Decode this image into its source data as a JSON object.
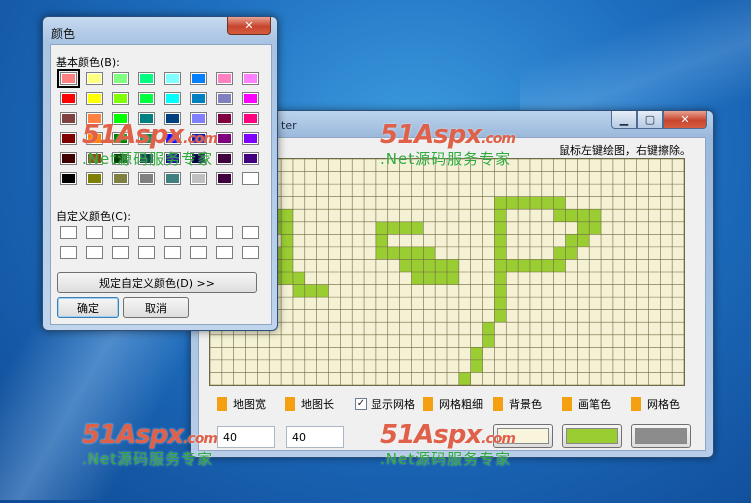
{
  "main_window": {
    "title": "ter",
    "hint": "鼠标左键绘图，右键擦除。",
    "grid": {
      "cols": 40,
      "rows": 18,
      "background_color": "#f4f1d4",
      "cell_line_color": "#6f6a43",
      "pen_color": "#9acd32",
      "painted_cells": [
        [
          0,
          4
        ],
        [
          1,
          4
        ],
        [
          2,
          4
        ],
        [
          3,
          4
        ],
        [
          4,
          4
        ],
        [
          5,
          4
        ],
        [
          6,
          4
        ],
        [
          0,
          5
        ],
        [
          4,
          5
        ],
        [
          5,
          5
        ],
        [
          6,
          5
        ],
        [
          0,
          6
        ],
        [
          2,
          6
        ],
        [
          6,
          6
        ],
        [
          0,
          7
        ],
        [
          1,
          7
        ],
        [
          2,
          7
        ],
        [
          3,
          7
        ],
        [
          5,
          7
        ],
        [
          6,
          7
        ],
        [
          0,
          8
        ],
        [
          4,
          8
        ],
        [
          5,
          8
        ],
        [
          6,
          8
        ],
        [
          0,
          9
        ],
        [
          1,
          9
        ],
        [
          5,
          9
        ],
        [
          6,
          9
        ],
        [
          7,
          9
        ],
        [
          0,
          10
        ],
        [
          2,
          10
        ],
        [
          7,
          10
        ],
        [
          8,
          10
        ],
        [
          9,
          10
        ],
        [
          14,
          5
        ],
        [
          15,
          5
        ],
        [
          16,
          5
        ],
        [
          17,
          5
        ],
        [
          14,
          6
        ],
        [
          14,
          7
        ],
        [
          15,
          7
        ],
        [
          16,
          7
        ],
        [
          17,
          7
        ],
        [
          18,
          7
        ],
        [
          18,
          8
        ],
        [
          19,
          8
        ],
        [
          20,
          8
        ],
        [
          17,
          9
        ],
        [
          18,
          9
        ],
        [
          19,
          9
        ],
        [
          20,
          9
        ],
        [
          16,
          8
        ],
        [
          17,
          8
        ],
        [
          24,
          3
        ],
        [
          25,
          3
        ],
        [
          26,
          3
        ],
        [
          27,
          3
        ],
        [
          28,
          3
        ],
        [
          29,
          3
        ],
        [
          24,
          4
        ],
        [
          29,
          4
        ],
        [
          30,
          4
        ],
        [
          31,
          4
        ],
        [
          32,
          4
        ],
        [
          24,
          5
        ],
        [
          31,
          5
        ],
        [
          32,
          5
        ],
        [
          24,
          6
        ],
        [
          30,
          6
        ],
        [
          31,
          6
        ],
        [
          24,
          7
        ],
        [
          29,
          7
        ],
        [
          30,
          7
        ],
        [
          24,
          8
        ],
        [
          25,
          8
        ],
        [
          26,
          8
        ],
        [
          27,
          8
        ],
        [
          28,
          8
        ],
        [
          29,
          8
        ],
        [
          24,
          9
        ],
        [
          24,
          10
        ],
        [
          24,
          11
        ],
        [
          24,
          12
        ],
        [
          23,
          13
        ],
        [
          23,
          14
        ],
        [
          22,
          15
        ],
        [
          22,
          16
        ],
        [
          21,
          17
        ]
      ]
    },
    "options": {
      "map_width_label": "地图宽",
      "map_height_label": "地图长",
      "show_grid_label": "显示网格",
      "grid_thickness_label": "网格粗细",
      "background_color_label": "背景色",
      "pen_color_label": "画笔色",
      "grid_color_label": "网格色",
      "show_grid_checked": "✓"
    },
    "inputs": {
      "map_width_value": "40",
      "map_height_value": "40"
    },
    "colors": {
      "background": "#f8f5dc",
      "pen": "#9acd32",
      "grid": "#8c8c8c"
    }
  },
  "color_dialog": {
    "title": "颜色",
    "close_glyph": "✕",
    "basic_colors_label": "基本颜色(B):",
    "custom_colors_label": "自定义颜色(C):",
    "define_custom_button": "规定自定义颜色(D) >>",
    "ok_button": "确定",
    "cancel_button": "取消",
    "basic_colors": [
      "#ff8080",
      "#ffff80",
      "#80ff80",
      "#00ff80",
      "#80ffff",
      "#0080ff",
      "#ff80c0",
      "#ff80ff",
      "#ff0000",
      "#ffff00",
      "#80ff00",
      "#00ff40",
      "#00ffff",
      "#0080c0",
      "#8080c0",
      "#ff00ff",
      "#804040",
      "#ff8040",
      "#00ff00",
      "#008080",
      "#004080",
      "#8080ff",
      "#800040",
      "#ff0080",
      "#800000",
      "#ff8000",
      "#008000",
      "#008040",
      "#0000ff",
      "#0000a0",
      "#800080",
      "#8000ff",
      "#400000",
      "#804000",
      "#004000",
      "#004040",
      "#000080",
      "#000040",
      "#400040",
      "#400080",
      "#000000",
      "#808000",
      "#808040",
      "#808080",
      "#408080",
      "#c0c0c0",
      "#400040",
      "#ffffff"
    ],
    "custom_colors": [
      "#ffffff",
      "#ffffff",
      "#ffffff",
      "#ffffff",
      "#ffffff",
      "#ffffff",
      "#ffffff",
      "#ffffff",
      "#ffffff",
      "#ffffff",
      "#ffffff",
      "#ffffff",
      "#ffffff",
      "#ffffff",
      "#ffffff",
      "#ffffff"
    ]
  },
  "caption": {
    "minimize": "▁",
    "maximize": "▢",
    "close": "✕"
  },
  "watermark": {
    "logo": "51Aspx",
    "domain": ".com",
    "subtitle": ".Net源码服务专家"
  }
}
